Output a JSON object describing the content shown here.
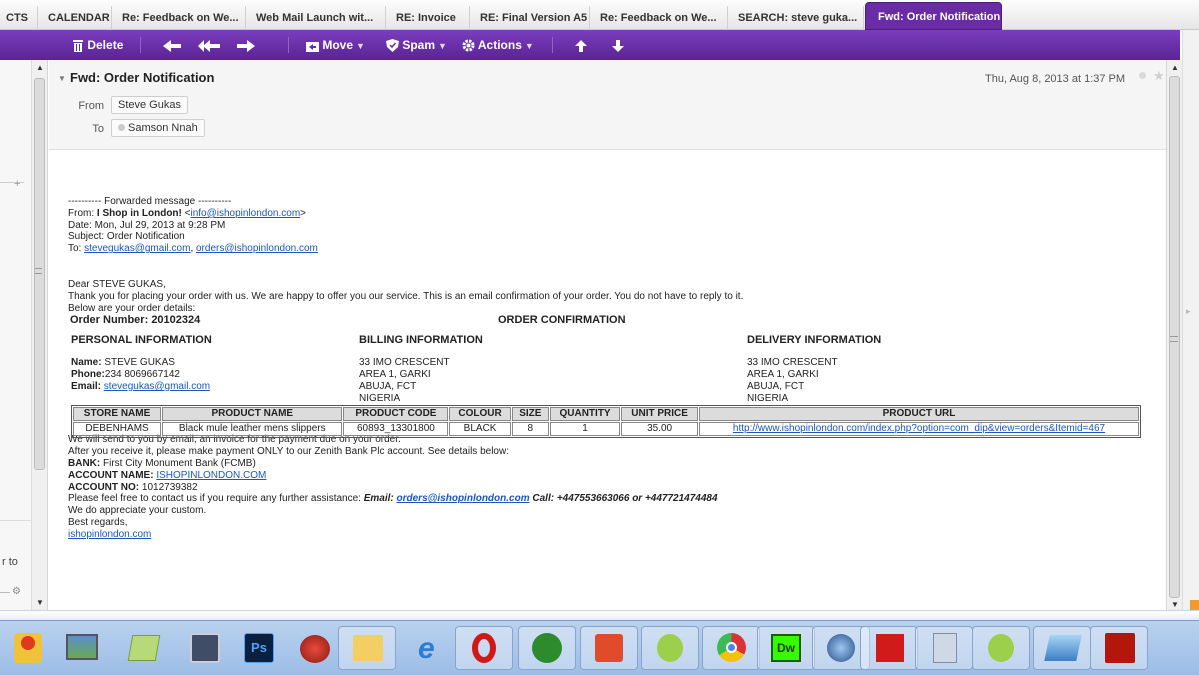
{
  "tabs": [
    "CTS",
    "CALENDAR",
    "Re: Feedback on We...",
    "Web Mail Launch wit...",
    "RE: Invoice",
    "RE: Final Version A5",
    "Re: Feedback on We...",
    "SEARCH: steve guka...",
    "Fwd: Order Notification"
  ],
  "toolbar": {
    "delete": "Delete",
    "move": "Move",
    "spam": "Spam",
    "actions": "Actions"
  },
  "left_panel": {
    "partial_text": "r to"
  },
  "message": {
    "subject": "Fwd: Order Notification",
    "date": "Thu, Aug 8, 2013 at 1:37 PM",
    "from_label": "From",
    "from_name": "Steve Gukas",
    "to_label": "To",
    "to_name": "Samson Nnah"
  },
  "body": {
    "fwd_line": "---------- Forwarded message ----------",
    "from_prefix": "From: ",
    "from_name": "I Shop in London!",
    "from_open": " <",
    "from_email": "info@ishopinlondon.com",
    "from_close": ">",
    "date_line": "Date: Mon, Jul 29, 2013 at 9:28 PM",
    "subject_line": "Subject: Order Notification",
    "to_prefix": "To: ",
    "to_email1": "stevegukas@gmail.com",
    "to_sep": ", ",
    "to_email2": "orders@ishopinlondon.com",
    "greeting": "Dear STEVE GUKAS,",
    "para1": "Thank you for placing your order with us. We are happy to offer you our service. This is an email confirmation of your order. You do not have to reply to it.",
    "para2": "Below are your order details:",
    "order_number_label": "Order Number:",
    "order_number": "20102324",
    "order_confirmation": "ORDER CONFIRMATION",
    "personal": {
      "heading": "PERSONAL INFORMATION",
      "name_label": "Name:",
      "name": " STEVE GUKAS",
      "phone_label": "Phone:",
      "phone": "234 8069667142",
      "email_label": "Email:",
      "email": "stevegukas@gmail.com"
    },
    "billing": {
      "heading": "BILLING INFORMATION",
      "lines": [
        "33 IMO CRESCENT",
        "AREA 1, GARKI",
        "ABUJA, FCT",
        "NIGERIA"
      ]
    },
    "delivery": {
      "heading": "DELIVERY INFORMATION",
      "lines": [
        "33 IMO CRESCENT",
        "AREA 1, GARKI",
        "ABUJA, FCT",
        "NIGERIA"
      ]
    },
    "table": {
      "headers": [
        "STORE NAME",
        "PRODUCT NAME",
        "PRODUCT CODE",
        "COLOUR",
        "SIZE",
        "QUANTITY",
        "UNIT PRICE",
        "PRODUCT URL"
      ],
      "row": [
        "DEBENHAMS",
        "Black mule leather mens slippers",
        "60893_13301800",
        "BLACK",
        "8",
        "1",
        "35.00"
      ],
      "url": "http://www.ishopinlondon.com/index.php?option=com_dip&view=orders&Itemid=467"
    },
    "after1": "We will send to you by email, an invoice for the payment due on your order.",
    "after2": "After you receive it, please make payment ONLY to our Zenith Bank Plc account. See details below:",
    "bank_label": "BANK:",
    "bank": " First City Monument Bank (FCMB)",
    "account_name_label": "ACCOUNT NAME:",
    "account_name": "ISHOPINLONDON.COM",
    "account_no_label": "ACCOUNT NO:",
    "account_no": " 1012739382",
    "contact_prefix": "Please feel free to contact us if you require any further assistance: ",
    "contact_email_label": "Email:",
    "contact_email": "orders@ishopinlondon.com",
    "contact_call": " Call: +447553663066 or +447721474484",
    "appreciate": "We do appreciate your custom.",
    "regards": "Best regards,",
    "signature": "ishopinlondon.com"
  },
  "taskbar": {
    "labels": [
      "Ps",
      "Dw"
    ]
  },
  "colors": {
    "toolbar": "#6a2ca6",
    "link": "#1a56c4",
    "taskbar": "#a9c6ea"
  }
}
